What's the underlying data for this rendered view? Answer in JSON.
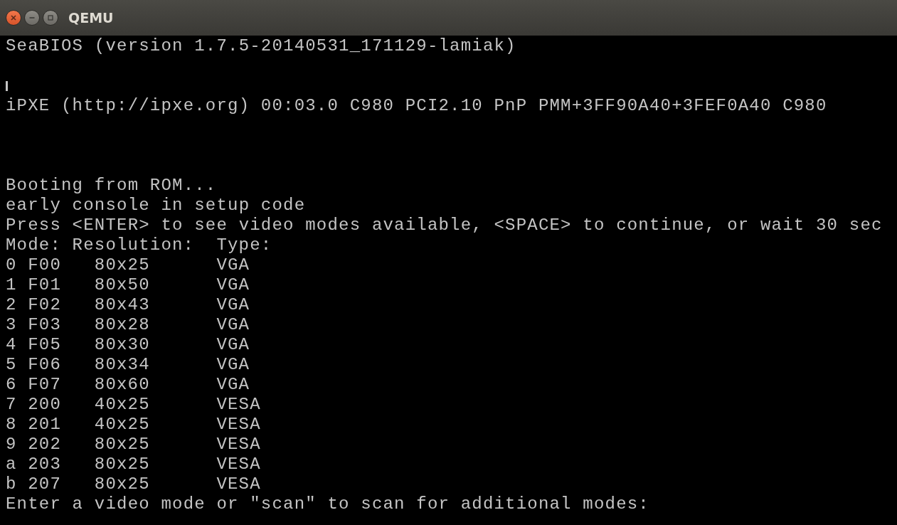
{
  "window": {
    "title": "QEMU"
  },
  "console": {
    "bios_banner": "SeaBIOS (version 1.7.5-20140531_171129-lamiak)",
    "cursor_visible": true,
    "ipxe_banner": "iPXE (http://ipxe.org) 00:03.0 C980 PCI2.10 PnP PMM+3FF90A40+3FEF0A40 C980",
    "boot_messages": [
      "Booting from ROM...",
      "early console in setup code",
      "Press <ENTER> to see video modes available, <SPACE> to continue, or wait 30 sec"
    ],
    "mode_table": {
      "columns": [
        "Mode:",
        "Resolution:",
        "Type:"
      ],
      "rows": [
        {
          "mode": "0 F00",
          "resolution": "80x25",
          "type": "VGA"
        },
        {
          "mode": "1 F01",
          "resolution": "80x50",
          "type": "VGA"
        },
        {
          "mode": "2 F02",
          "resolution": "80x43",
          "type": "VGA"
        },
        {
          "mode": "3 F03",
          "resolution": "80x28",
          "type": "VGA"
        },
        {
          "mode": "4 F05",
          "resolution": "80x30",
          "type": "VGA"
        },
        {
          "mode": "5 F06",
          "resolution": "80x34",
          "type": "VGA"
        },
        {
          "mode": "6 F07",
          "resolution": "80x60",
          "type": "VGA"
        },
        {
          "mode": "7 200",
          "resolution": "40x25",
          "type": "VESA"
        },
        {
          "mode": "8 201",
          "resolution": "40x25",
          "type": "VESA"
        },
        {
          "mode": "9 202",
          "resolution": "80x25",
          "type": "VESA"
        },
        {
          "mode": "a 203",
          "resolution": "80x25",
          "type": "VESA"
        },
        {
          "mode": "b 207",
          "resolution": "80x25",
          "type": "VESA"
        }
      ]
    },
    "prompt": "Enter a video mode or \"scan\" to scan for additional modes:"
  }
}
